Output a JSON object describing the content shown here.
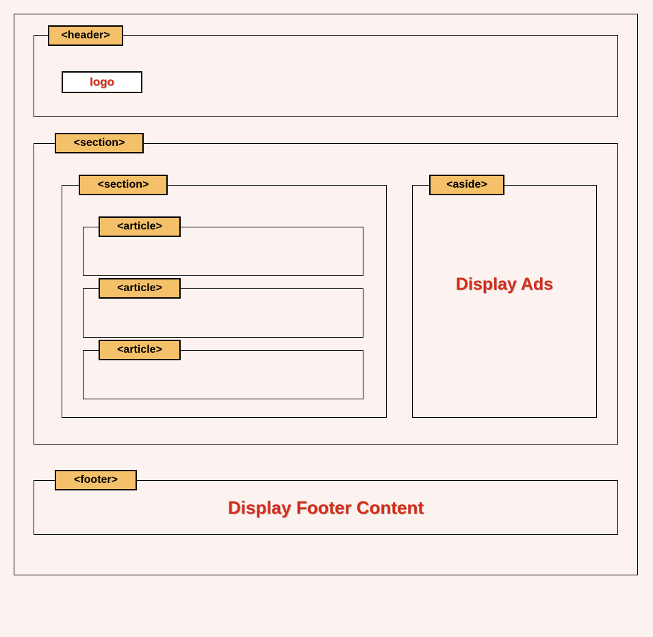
{
  "header": {
    "tag": "<header>",
    "logo": "logo"
  },
  "section_outer": {
    "tag": "<section>"
  },
  "section_inner": {
    "tag": "<section>",
    "articles": [
      {
        "tag": "<article>"
      },
      {
        "tag": "<article>"
      },
      {
        "tag": "<article>"
      }
    ]
  },
  "aside": {
    "tag": "<aside>",
    "content": "Display Ads"
  },
  "footer": {
    "tag": "<footer>",
    "content": "Display Footer Content"
  }
}
